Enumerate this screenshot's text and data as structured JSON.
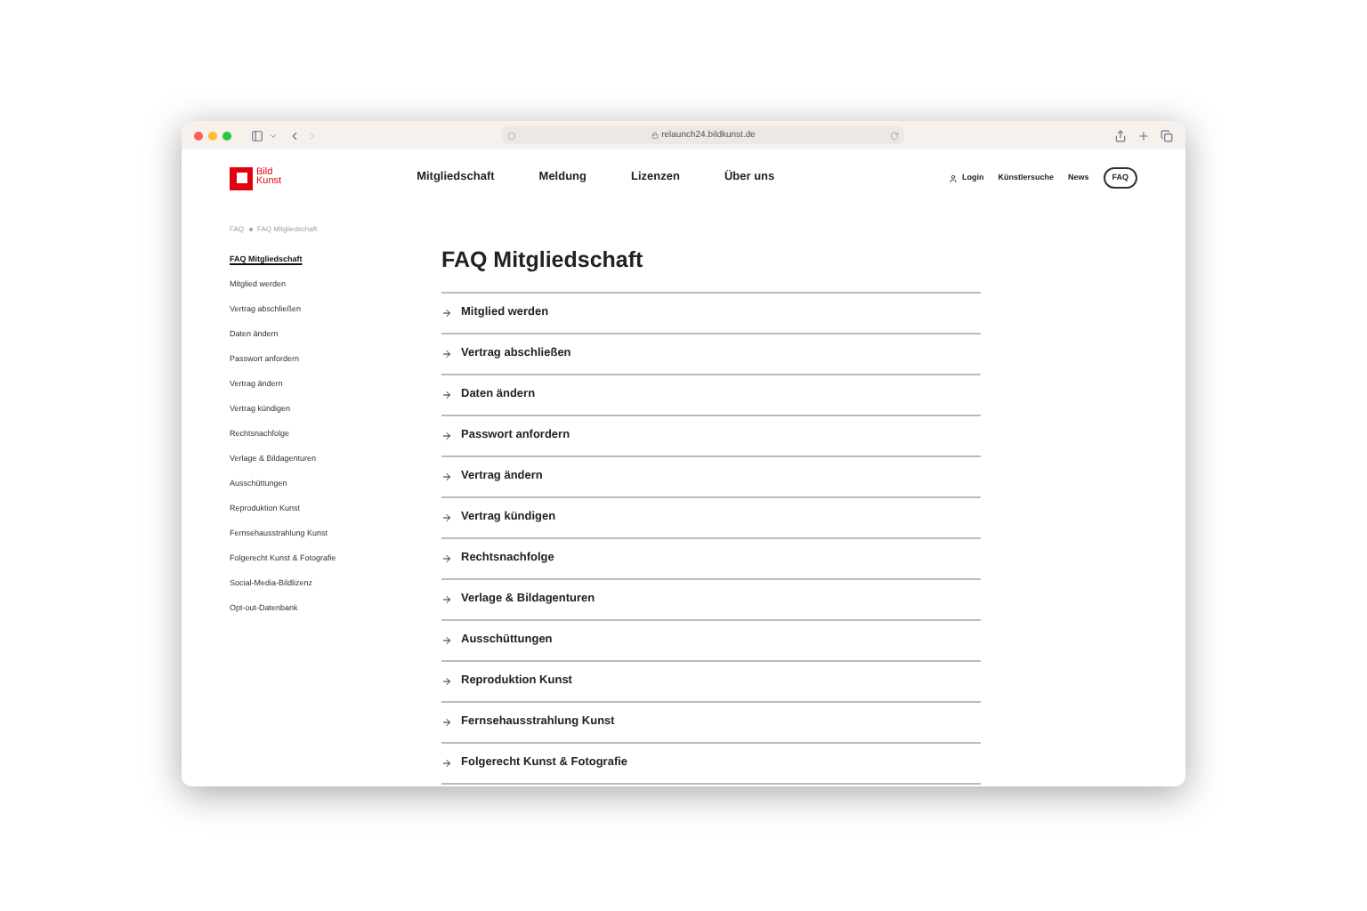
{
  "browser": {
    "address": "relaunch24.bildkunst.de"
  },
  "header": {
    "logo": [
      "Bild",
      "Kunst"
    ],
    "nav": [
      {
        "label": "Mitgliedschaft",
        "selected": false
      },
      {
        "label": "Meldung",
        "selected": false
      },
      {
        "label": "Lizenzen",
        "selected": false
      },
      {
        "label": "Über uns",
        "selected": false
      }
    ],
    "utility": [
      {
        "label": "Login",
        "kind": "user"
      },
      {
        "label": "Künstlersuche",
        "kind": "link"
      },
      {
        "label": "News",
        "kind": "link"
      },
      {
        "label": "FAQ",
        "kind": "pill"
      }
    ]
  },
  "breadcrumb": [
    "FAQ",
    "FAQ Mitgliedschaft"
  ],
  "sidebar": {
    "items": [
      {
        "label": "FAQ Mitgliedschaft",
        "selected": true
      },
      {
        "label": "Mitglied werden",
        "selected": false
      },
      {
        "label": "Vertrag abschließen",
        "selected": false
      },
      {
        "label": "Daten ändern",
        "selected": false
      },
      {
        "label": "Passwort anfordern",
        "selected": false
      },
      {
        "label": "Vertrag ändern",
        "selected": false
      },
      {
        "label": "Vertrag kündigen",
        "selected": false
      },
      {
        "label": "Rechtsnachfolge",
        "selected": false
      },
      {
        "label": "Verlage & Bildagenturen",
        "selected": false
      },
      {
        "label": "Ausschüttungen",
        "selected": false
      },
      {
        "label": "Reproduktion Kunst",
        "selected": false
      },
      {
        "label": "Fernsehausstrahlung Kunst",
        "selected": false
      },
      {
        "label": "Folgerecht Kunst & Fotografie",
        "selected": false
      },
      {
        "label": "Social-Media-Bildlizenz",
        "selected": false
      },
      {
        "label": "Opt-out-Datenbank",
        "selected": false
      }
    ]
  },
  "main": {
    "title": "FAQ Mitgliedschaft",
    "faq": [
      "Mitglied werden",
      "Vertrag abschließen",
      "Daten ändern",
      "Passwort anfordern",
      "Vertrag ändern",
      "Vertrag kündigen",
      "Rechtsnachfolge",
      "Verlage & Bildagenturen",
      "Ausschüttungen",
      "Reproduktion Kunst",
      "Fernsehausstrahlung Kunst",
      "Folgerecht Kunst & Fotografie"
    ]
  }
}
